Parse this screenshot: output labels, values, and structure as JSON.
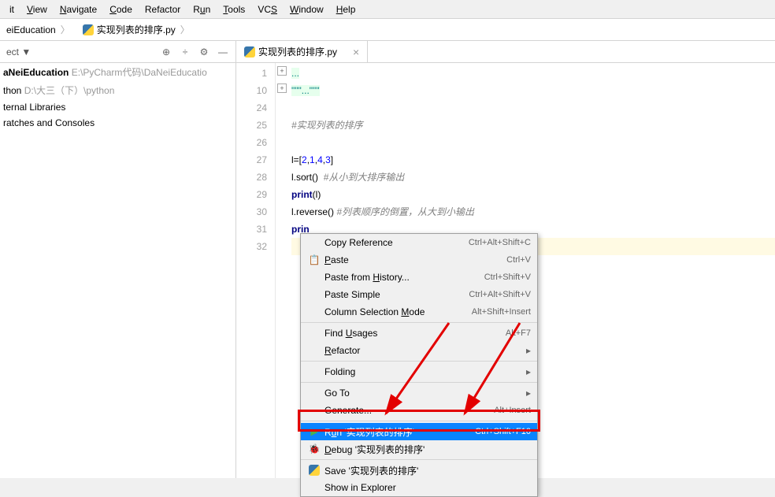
{
  "menu": {
    "items": [
      "it",
      "View",
      "Navigate",
      "Code",
      "Refactor",
      "Run",
      "Tools",
      "VCS",
      "Window",
      "Help"
    ],
    "underlines": [
      "",
      "V",
      "N",
      "C",
      "",
      "u",
      "T",
      "S",
      "W",
      "H"
    ]
  },
  "breadcrumb": {
    "project": "eiEducation",
    "file": "实现列表的排序.py"
  },
  "toolbar": {
    "left_label": "ect",
    "arrow": "▼"
  },
  "tab": {
    "name": "实现列表的排序.py"
  },
  "tree": {
    "root": "aNeiEducation",
    "root_path": "E:\\PyCharm代码\\DaNeiEducatio",
    "items": [
      {
        "label": "thon",
        "path": "D:\\大三（下）\\python"
      },
      {
        "label": "ternal Libraries",
        "path": ""
      },
      {
        "label": "ratches and Consoles",
        "path": ""
      }
    ]
  },
  "gutter_lines": [
    "1",
    "10",
    "24",
    "25",
    "26",
    "27",
    "28",
    "29",
    "30",
    "31",
    "32"
  ],
  "code_lines": [
    {
      "type": "fold",
      "text": "..."
    },
    {
      "type": "fold2",
      "text": "\"\"\"...\"\"\""
    },
    {
      "type": "blank",
      "text": ""
    },
    {
      "type": "comment",
      "text": "#实现列表的排序"
    },
    {
      "type": "blank",
      "text": ""
    },
    {
      "type": "assign",
      "text": "l=[2,1,4,3]"
    },
    {
      "type": "call_c",
      "call": "l.sort()",
      "comment": "  #从小到大排序输出"
    },
    {
      "type": "print",
      "text": "print(l)"
    },
    {
      "type": "call_c",
      "call": "l.reverse()",
      "comment": " #列表顺序的倒置，从大到小输出"
    },
    {
      "type": "print_cut",
      "text": "prin"
    },
    {
      "type": "caret",
      "text": ""
    }
  ],
  "context_menu": [
    {
      "icon": "",
      "label": "Copy Reference",
      "u": "",
      "shortcut": "Ctrl+Alt+Shift+C",
      "arrow": false
    },
    {
      "icon": "📋",
      "label": "Paste",
      "u": "P",
      "shortcut": "Ctrl+V",
      "arrow": false
    },
    {
      "icon": "",
      "label": "Paste from History...",
      "u": "H",
      "shortcut": "Ctrl+Shift+V",
      "arrow": false
    },
    {
      "icon": "",
      "label": "Paste Simple",
      "u": "",
      "shortcut": "Ctrl+Alt+Shift+V",
      "arrow": false
    },
    {
      "icon": "",
      "label": "Column Selection Mode",
      "u": "M",
      "shortcut": "Alt+Shift+Insert",
      "arrow": false
    },
    {
      "sep": true
    },
    {
      "icon": "",
      "label": "Find Usages",
      "u": "U",
      "shortcut": "Alt+F7",
      "arrow": false
    },
    {
      "icon": "",
      "label": "Refactor",
      "u": "R",
      "shortcut": "",
      "arrow": true
    },
    {
      "sep": true
    },
    {
      "icon": "",
      "label": "Folding",
      "u": "",
      "shortcut": "",
      "arrow": true
    },
    {
      "sep": true
    },
    {
      "icon": "",
      "label": "Go To",
      "u": "",
      "shortcut": "",
      "arrow": true
    },
    {
      "icon": "",
      "label": "Generate...",
      "u": "",
      "shortcut": "Alt+Insert",
      "arrow": false
    },
    {
      "sep": true
    },
    {
      "icon": "▶",
      "label": "Run '实现列表的排序'",
      "u": "u",
      "shortcut": "Ctrl+Shift+F10",
      "arrow": false,
      "selected": true
    },
    {
      "icon": "🐞",
      "label": "Debug '实现列表的排序'",
      "u": "D",
      "shortcut": "",
      "arrow": false
    },
    {
      "sep": true
    },
    {
      "icon": "py",
      "label": "Save '实现列表的排序'",
      "u": "",
      "shortcut": "",
      "arrow": false
    },
    {
      "icon": "",
      "label": "Show in Explorer",
      "u": "",
      "shortcut": "",
      "arrow": false
    }
  ]
}
